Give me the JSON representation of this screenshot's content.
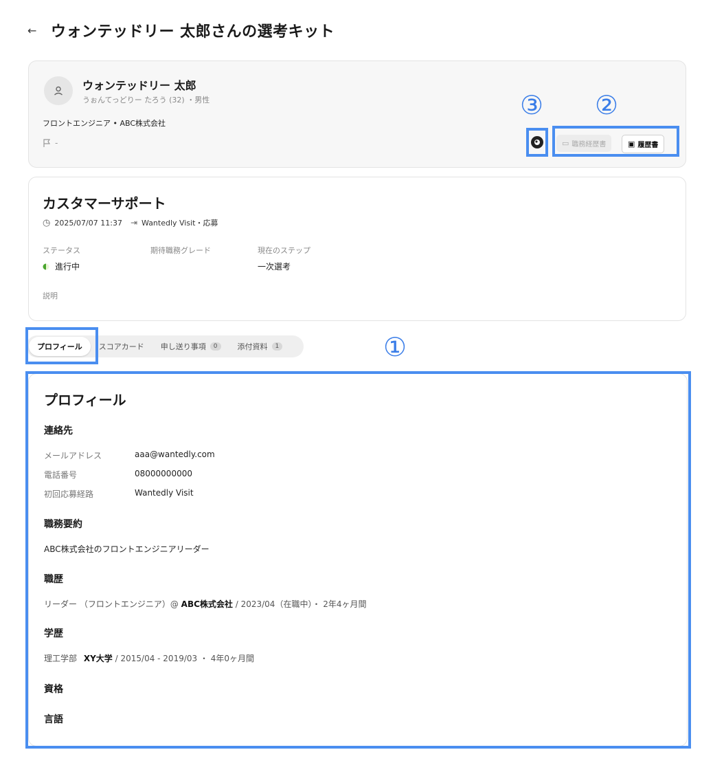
{
  "header": {
    "title": "ウォンテッドリー 太郎さんの選考キット"
  },
  "profile": {
    "name": "ウォンテッドリー 太郎",
    "kana": "うぉんてっどりー たろう (32) ・男性",
    "job": "フロントエンジニア • ABC株式会社",
    "flag_value": "-",
    "docs": {
      "shokumu": "職務経歴書",
      "rireki": "履歴書"
    }
  },
  "annotations": {
    "one": "①",
    "two": "②",
    "three": "③"
  },
  "position": {
    "title": "カスタマーサポート",
    "datetime": "2025/07/07 11:37",
    "source": "Wantedly Visit・応募",
    "status_label": "ステータス",
    "status_value": "進行中",
    "grade_label": "期待職務グレード",
    "step_label": "現在のステップ",
    "step_value": "一次選考",
    "desc_label": "説明"
  },
  "tabs": [
    {
      "label": "プロフィール"
    },
    {
      "label": "スコアカード"
    },
    {
      "label": "申し送り事項",
      "count": "0"
    },
    {
      "label": "添付資料",
      "count": "1"
    }
  ],
  "panel": {
    "title": "プロフィール",
    "contact": {
      "heading": "連絡先",
      "email_label": "メールアドレス",
      "email": "aaa@wantedly.com",
      "phone_label": "電話番号",
      "phone": "08000000000",
      "route_label": "初回応募経路",
      "route": "Wantedly Visit"
    },
    "summary": {
      "heading": "職務要約",
      "text": "ABC株式会社のフロントエンジニアリーダー"
    },
    "career": {
      "heading": "職歴",
      "role": "リーダー （フロントエンジニア）@",
      "company": "ABC株式会社",
      "period": "/ 2023/04（在職中）・ 2年4ヶ月間"
    },
    "education": {
      "heading": "学歴",
      "dept": "理工学部",
      "school": "XY大学",
      "period": "/ 2015/04 - 2019/03 ・ 4年0ヶ月間"
    },
    "qualification": {
      "heading": "資格"
    },
    "language": {
      "heading": "言語"
    }
  }
}
